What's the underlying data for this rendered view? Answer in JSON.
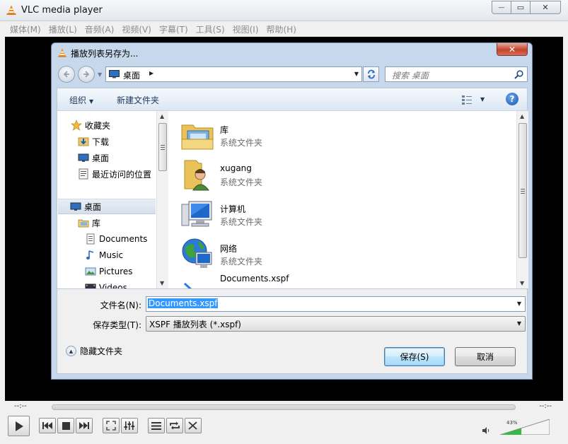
{
  "vlc": {
    "title": "VLC media player",
    "menu": [
      "媒体(M)",
      "播放(L)",
      "音频(A)",
      "视频(V)",
      "字幕(T)",
      "工具(S)",
      "视图(I)",
      "帮助(H)"
    ],
    "time_elapsed": "--:--",
    "time_total": "--:--",
    "volume_label": "43%",
    "volume_level": 0.43,
    "window_buttons": {
      "minimize": "—",
      "maximize": "▭",
      "close": "✕"
    }
  },
  "dialog": {
    "title": "播放列表另存为...",
    "address": {
      "location": "桌面",
      "arrow": "▶"
    },
    "search": {
      "placeholder": "搜索 桌面"
    },
    "toolbar": {
      "organize": "组织",
      "new_folder": "新建文件夹"
    },
    "nav": {
      "favorites_header": "收藏夹",
      "favorites": [
        "下载",
        "桌面",
        "最近访问的位置"
      ],
      "desktop": "桌面",
      "libraries": "库",
      "library_items": [
        "Documents",
        "Music",
        "Pictures",
        "Videos"
      ]
    },
    "files": [
      {
        "name": "库",
        "type": "系统文件夹",
        "icon": "library-icon"
      },
      {
        "name": "xugang",
        "type": "系统文件夹",
        "icon": "user-folder-icon"
      },
      {
        "name": "计算机",
        "type": "系统文件夹",
        "icon": "computer-icon"
      },
      {
        "name": "网络",
        "type": "系统文件夹",
        "icon": "network-icon"
      },
      {
        "name": "Documents.xspf",
        "type": "",
        "icon": "playlist-file-icon"
      }
    ],
    "form": {
      "filename_label": "文件名(N):",
      "filename_value": "Documents.xspf",
      "filetype_label": "保存类型(T):",
      "filetype_value": "XSPF 播放列表 (*.xspf)"
    },
    "hide_folders": "隐藏文件夹",
    "buttons": {
      "save": "保存(S)",
      "cancel": "取消"
    },
    "close_glyph": "✕"
  }
}
